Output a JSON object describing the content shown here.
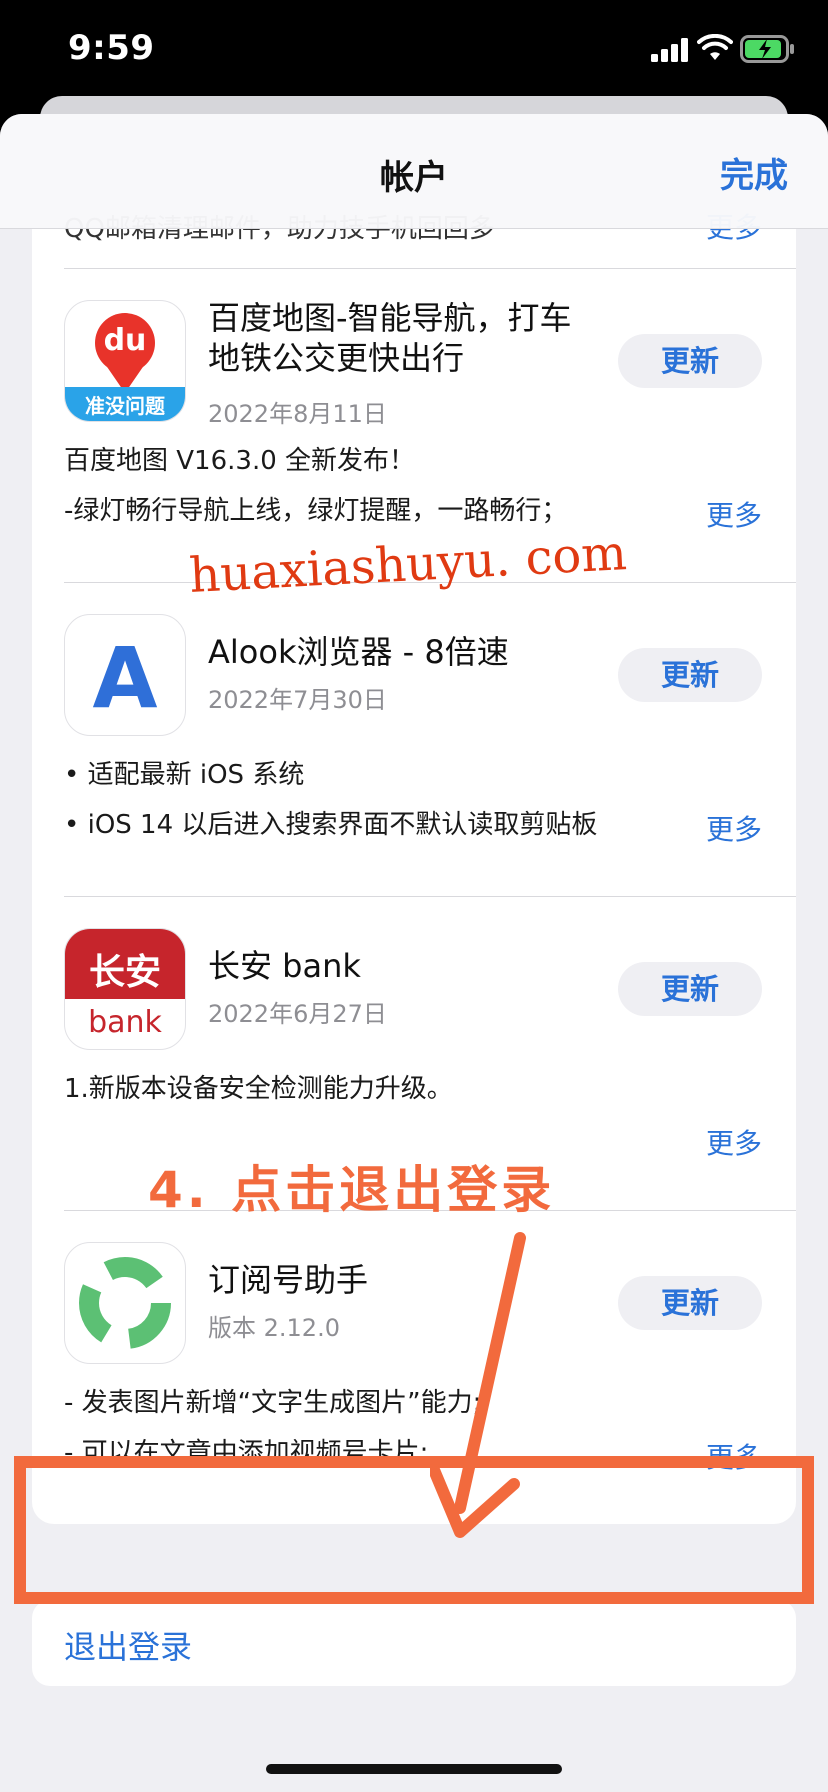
{
  "status_bar": {
    "time": "9:59"
  },
  "nav": {
    "title": "帐户",
    "done_label": "完成"
  },
  "cut_off": {
    "text": "QQ邮箱清理邮件，助力技手机回回多",
    "more_label": "更多"
  },
  "apps": [
    {
      "name": "百度地图-智能导航，打车地铁公交更快出行",
      "date": "2022年8月11日",
      "update_label": "更新",
      "icon": "baidu-map-icon",
      "icon_texts": {
        "main": "du",
        "banner": "准没问题"
      },
      "notes": [
        "百度地图 V16.3.0 全新发布！",
        "-绿灯畅行导航上线，绿灯提醒，一路畅行；"
      ],
      "more_label": "更多"
    },
    {
      "name": "Alook浏览器 - 8倍速",
      "date": "2022年7月30日",
      "update_label": "更新",
      "icon": "alook-browser-icon",
      "icon_texts": {
        "main": "A"
      },
      "notes": [
        "• 适配最新 iOS 系统",
        "• iOS 14 以后进入搜索界面不默认读取剪贴板"
      ],
      "more_label": "更多"
    },
    {
      "name": "长安 bank",
      "date": "2022年6月27日",
      "update_label": "更新",
      "icon": "changan-bank-icon",
      "icon_texts": {
        "top": "长安",
        "bottom": "bank"
      },
      "notes": [
        "1.新版本设备安全检测能力升级。"
      ],
      "more_label": "更多"
    },
    {
      "name": "订阅号助手",
      "date": "版本 2.12.0",
      "update_label": "更新",
      "icon": "subscription-assistant-icon",
      "notes": [
        "- 发表图片新增“文字生成图片”能力;",
        "- 可以在文章中添加视频号卡片;"
      ],
      "more_label": "更多"
    }
  ],
  "logout": {
    "label": "退出登录"
  },
  "annotations": {
    "watermark": "huaxiashuyu. com",
    "instruction": "4. 点击退出登录",
    "highlight_color": "#f26a3d"
  },
  "colors": {
    "accent": "#2a72d8",
    "background": "#efeff3"
  }
}
